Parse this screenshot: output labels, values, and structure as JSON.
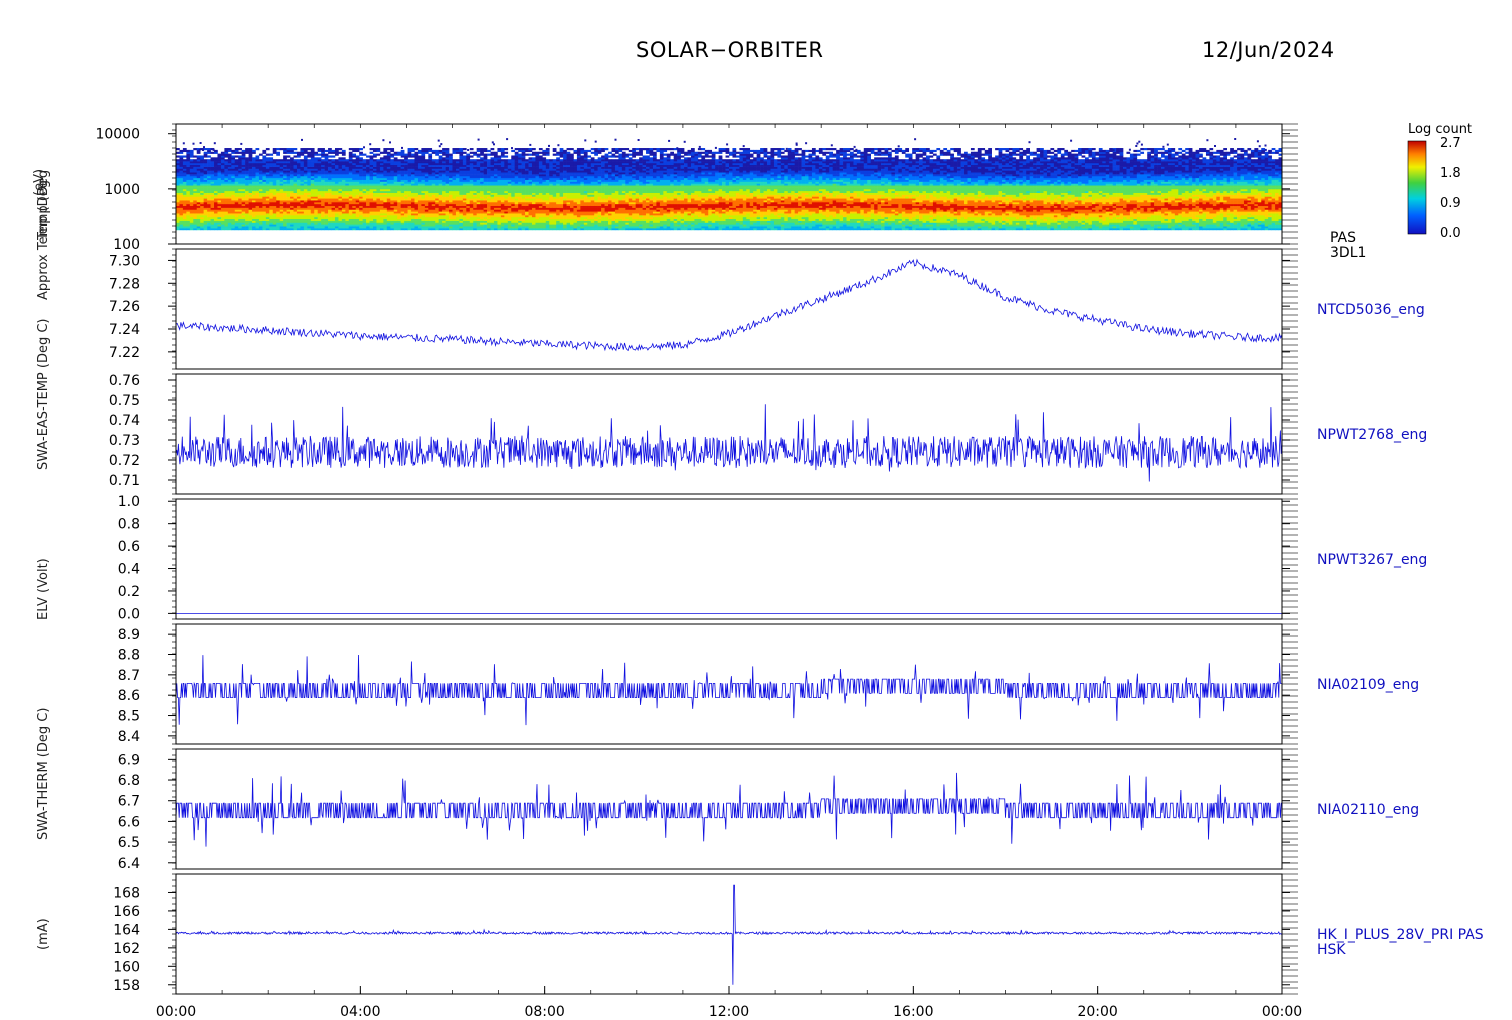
{
  "header": {
    "mission": "SOLAR−ORBITER",
    "date": "12/Jun/2024"
  },
  "colorbar": {
    "title": "Log count",
    "ticks": [
      "2.7",
      "1.8",
      "0.9",
      "0.0"
    ]
  },
  "rotated_ylabels": [
    "Temp (Deg",
    "Approx Temp (Deg",
    "SWA-EAS-TEMP (Deg C)",
    "ELV (Volt)",
    "SWA-THERM (Deg C)",
    "(mA)"
  ],
  "chart_data": {
    "type": "line",
    "xaxis": {
      "ticks": [
        "00:00",
        "04:00",
        "08:00",
        "12:00",
        "16:00",
        "20:00",
        "00:00"
      ],
      "range_hours": [
        0,
        24
      ]
    },
    "panels": [
      {
        "id": "pas-spectrogram",
        "type": "heatmap",
        "ylabel": "(eV)",
        "yscale": "log",
        "ylim": [
          100,
          15000
        ],
        "yticks": [
          "10000",
          "1000",
          "100"
        ],
        "ytick_values": [
          10000,
          1000,
          100
        ],
        "right_label": [
          "PAS",
          "3DL1"
        ],
        "peak_energy_ev": 480,
        "band_energy_ev": [
          180,
          5500
        ],
        "color_range": [
          0.0,
          2.7
        ]
      },
      {
        "id": "ntcd5036",
        "type": "line",
        "right_label": "NTCD5036_eng",
        "ylim": [
          7.205,
          7.31
        ],
        "yticks": [
          "7.30",
          "7.28",
          "7.26",
          "7.24",
          "7.22"
        ],
        "ytick_values": [
          7.3,
          7.28,
          7.26,
          7.24,
          7.22
        ],
        "x_hours": [
          0,
          2,
          4,
          6,
          8,
          10,
          11,
          12,
          13,
          14,
          15,
          16,
          17,
          18,
          19,
          20,
          21,
          22,
          23,
          24
        ],
        "y": [
          7.243,
          7.239,
          7.234,
          7.231,
          7.227,
          7.224,
          7.226,
          7.236,
          7.252,
          7.266,
          7.281,
          7.298,
          7.287,
          7.268,
          7.256,
          7.248,
          7.24,
          7.236,
          7.233,
          7.232
        ]
      },
      {
        "id": "npwt2768",
        "type": "line",
        "right_label": "NPWT2768_eng",
        "ylim": [
          7.2,
          7.65
        ],
        "yticks": [],
        "ytick_values": []
      },
      {
        "id": "npwt2768-b",
        "type": "line",
        "right_label": "NPWT2768_eng",
        "ylim": [
          0.703,
          0.763
        ],
        "yticks": [
          "0.76",
          "0.75",
          "0.74",
          "0.73",
          "0.72",
          "0.71"
        ],
        "ytick_values": [
          0.76,
          0.75,
          0.74,
          0.73,
          0.72,
          0.71
        ],
        "mean": 0.724,
        "noise": 0.01
      },
      {
        "id": "npwt3267",
        "type": "line",
        "right_label": "NPWT3267_eng",
        "ylim": [
          -0.05,
          1.02
        ],
        "yticks": [
          "1.0",
          "0.8",
          "0.6",
          "0.4",
          "0.2",
          "0.0"
        ],
        "ytick_values": [
          1.0,
          0.8,
          0.6,
          0.4,
          0.2,
          0.0
        ],
        "mean": 0.0,
        "noise": 0.0
      },
      {
        "id": "nia02109",
        "type": "line",
        "right_label": "NIA02109_eng",
        "ylim": [
          8.36,
          8.95
        ],
        "yticks": [
          "8.9",
          "8.8",
          "8.7",
          "8.6",
          "8.5",
          "8.4"
        ],
        "ytick_values": [
          8.9,
          8.8,
          8.7,
          8.6,
          8.5,
          8.4
        ],
        "mean": 8.63,
        "noise": 0.07
      },
      {
        "id": "nia02110",
        "type": "line",
        "right_label": "NIA02110_eng",
        "ylim": [
          6.37,
          6.95
        ],
        "yticks": [
          "6.9",
          "6.8",
          "6.7",
          "6.6",
          "6.5",
          "6.4"
        ],
        "ytick_values": [
          6.9,
          6.8,
          6.7,
          6.6,
          6.5,
          6.4
        ],
        "mean": 6.66,
        "noise": 0.07
      },
      {
        "id": "hk-i-plus-28v",
        "type": "line",
        "right_label": [
          "HK_I_PLUS_28V_PRI PAS",
          "HSK"
        ],
        "ylim": [
          157,
          170
        ],
        "yticks": [
          "168",
          "166",
          "164",
          "162",
          "160",
          "158"
        ],
        "ytick_values": [
          168,
          166,
          164,
          162,
          160,
          158
        ],
        "mean": 163.6,
        "noise": 0.15,
        "spike_hour": 12.1,
        "spike_min": 158.0,
        "spike_max": 168.8
      }
    ]
  }
}
